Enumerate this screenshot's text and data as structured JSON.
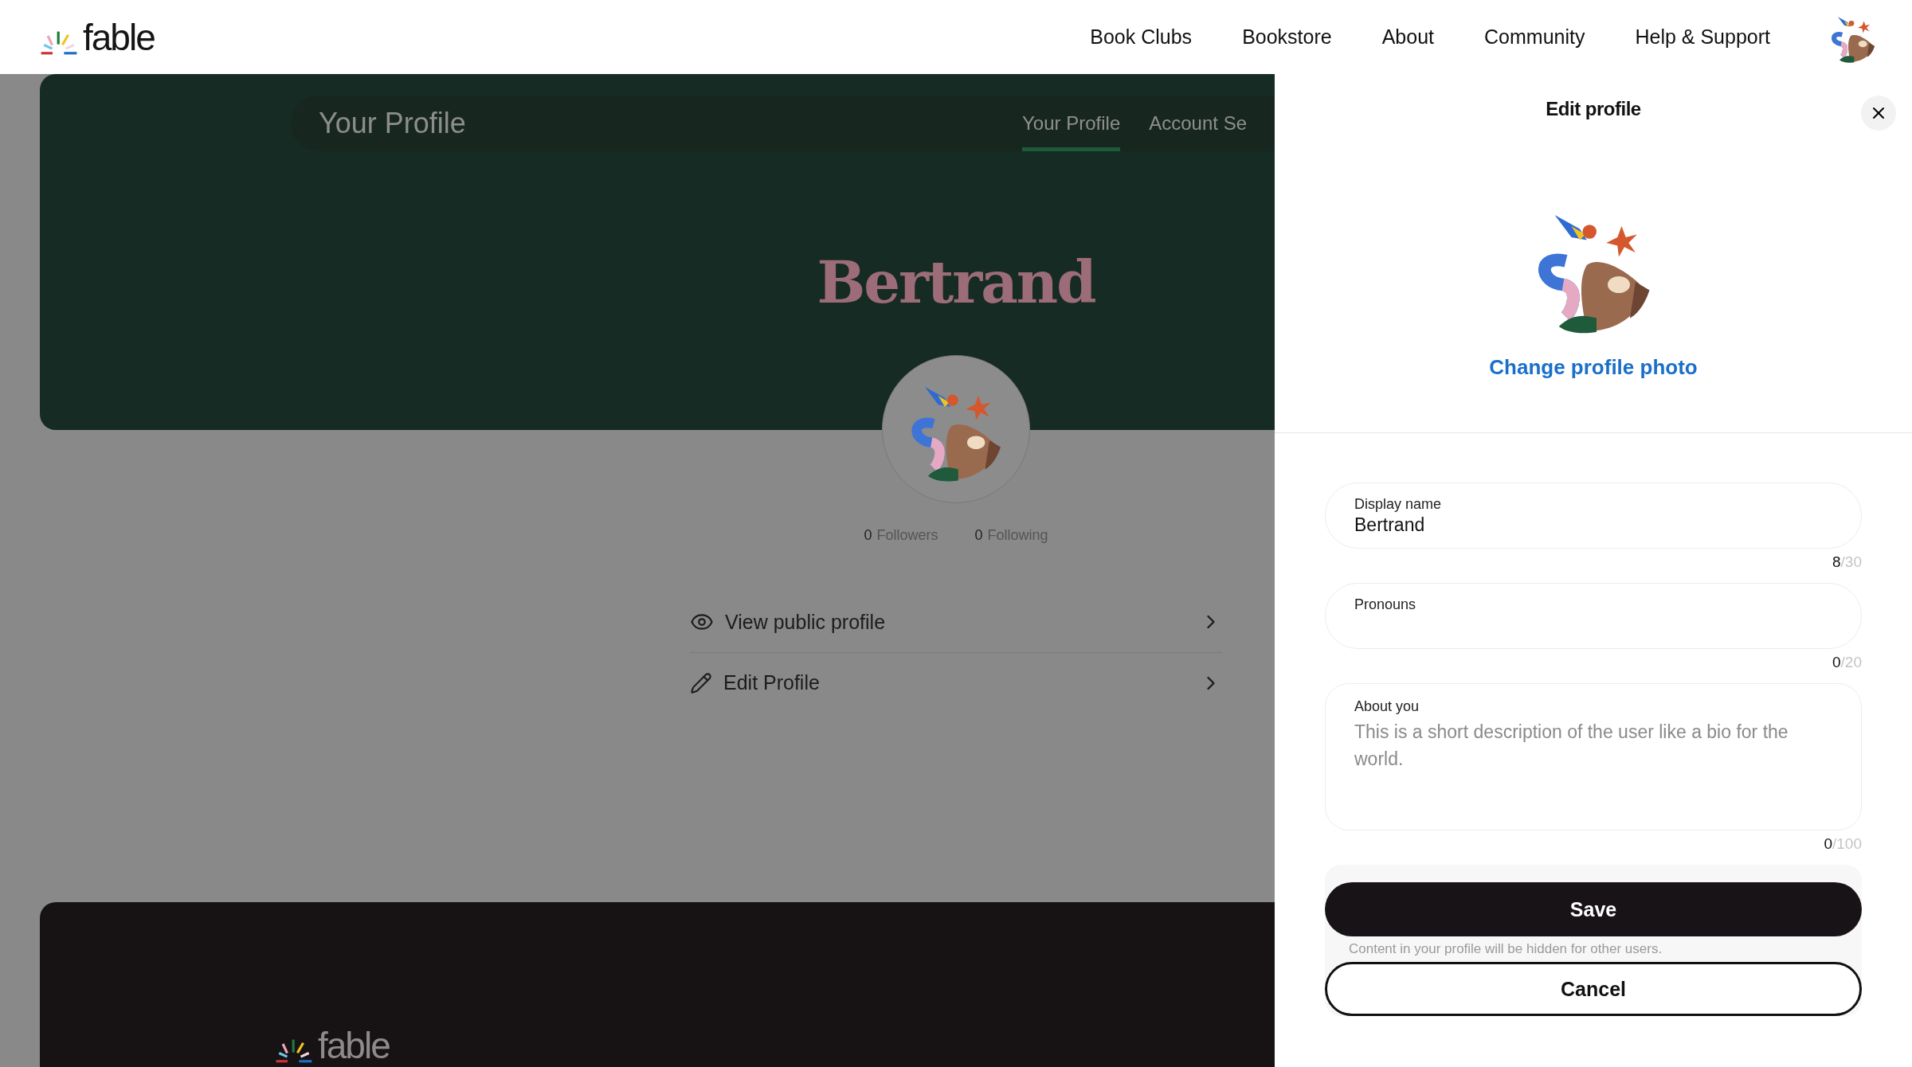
{
  "header": {
    "logo": "fable",
    "nav": [
      "Book Clubs",
      "Bookstore",
      "About",
      "Community",
      "Help & Support"
    ]
  },
  "profile_page": {
    "page_title": "Your Profile",
    "tabs": [
      {
        "label": "Your Profile",
        "selected": true
      },
      {
        "label": "Account Se",
        "selected": false
      }
    ],
    "display_name": "Bertrand",
    "stats": [
      {
        "count": "0",
        "label": "Followers"
      },
      {
        "count": "0",
        "label": "Following"
      }
    ],
    "menu": [
      {
        "kind": "view",
        "label": "View public profile"
      },
      {
        "kind": "edit",
        "label": "Edit Profile"
      }
    ],
    "footer_logo": "fable"
  },
  "edit_panel": {
    "title": "Edit profile",
    "change_photo": "Change profile photo",
    "fields": [
      {
        "kind": "line",
        "label": "Display name",
        "value": "Bertrand",
        "count": "8",
        "limit": "/30"
      },
      {
        "kind": "line",
        "label": "Pronouns",
        "count": "0",
        "limit": "/20"
      },
      {
        "kind": "area",
        "label": "About you",
        "placeholder": "This is a short description of the user like a bio for the world.",
        "count": "0",
        "limit": "/100"
      }
    ],
    "save": "Save",
    "notice": "Content in your profile will be hidden for other users.",
    "cancel": "Cancel"
  }
}
